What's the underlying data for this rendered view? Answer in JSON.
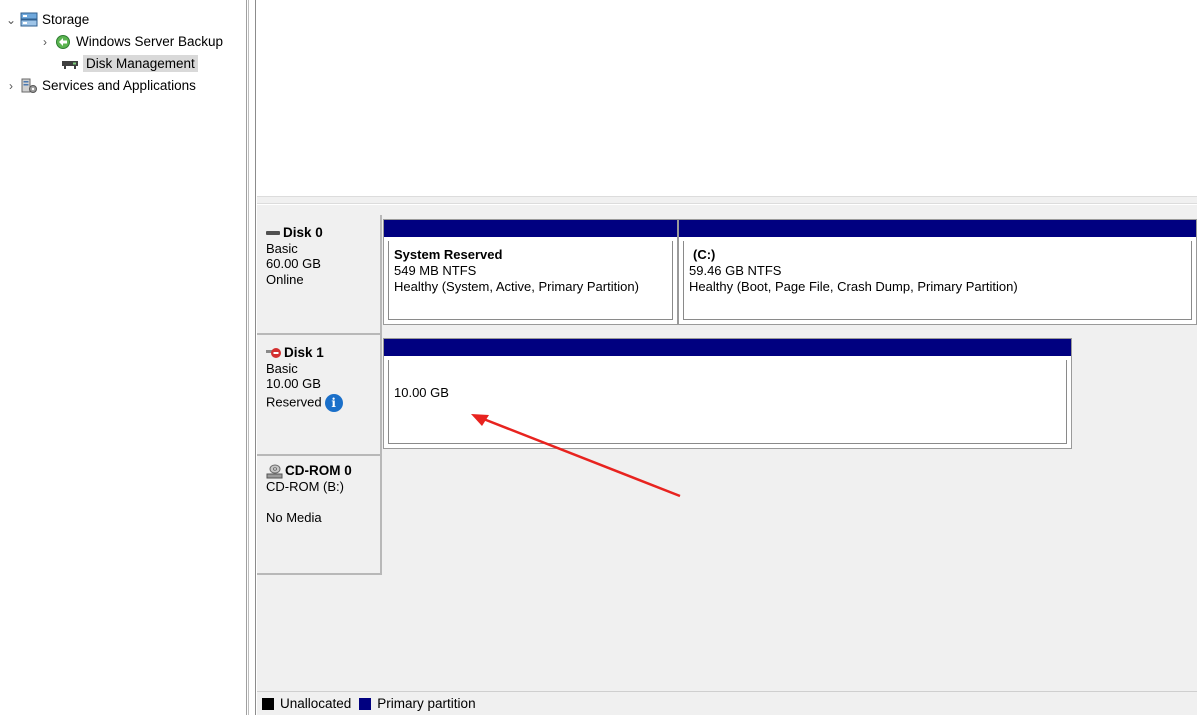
{
  "tree": {
    "items": [
      {
        "label": "Storage",
        "arrow": "⌄",
        "icon": "storage-icon"
      },
      {
        "label": "Windows Server Backup",
        "arrow": "›",
        "icon": "backup-icon"
      },
      {
        "label": "Disk Management",
        "arrow": "",
        "icon": "disk-management-icon",
        "selected": true
      },
      {
        "label": "Services and Applications",
        "arrow": "›",
        "icon": "services-icon"
      }
    ]
  },
  "disks": [
    {
      "name": "Disk 0",
      "type": "Basic",
      "size": "60.00 GB",
      "status": "Online",
      "partitions": [
        {
          "title": "System Reserved",
          "info": "549 MB NTFS",
          "health": "Healthy (System, Active, Primary Partition)"
        },
        {
          "title": "(C:)",
          "info": "59.46 GB NTFS",
          "health": "Healthy (Boot, Page File, Crash Dump, Primary Partition)"
        }
      ]
    },
    {
      "name": "Disk 1",
      "type": "Basic",
      "size": "10.00 GB",
      "status": "Reserved",
      "partitions": [
        {
          "title": "",
          "info": "10.00 GB",
          "health": ""
        }
      ]
    },
    {
      "name": "CD-ROM 0",
      "type": "CD-ROM (B:)",
      "size": "",
      "status": "No Media",
      "partitions": []
    }
  ],
  "legend": [
    {
      "label": "Unallocated",
      "color": "#000000"
    },
    {
      "label": "Primary partition",
      "color": "#000080"
    }
  ],
  "colors": {
    "partition_bar": "#000080",
    "annotation_arrow": "#e8231f",
    "info_icon": "#1a6fc9"
  }
}
